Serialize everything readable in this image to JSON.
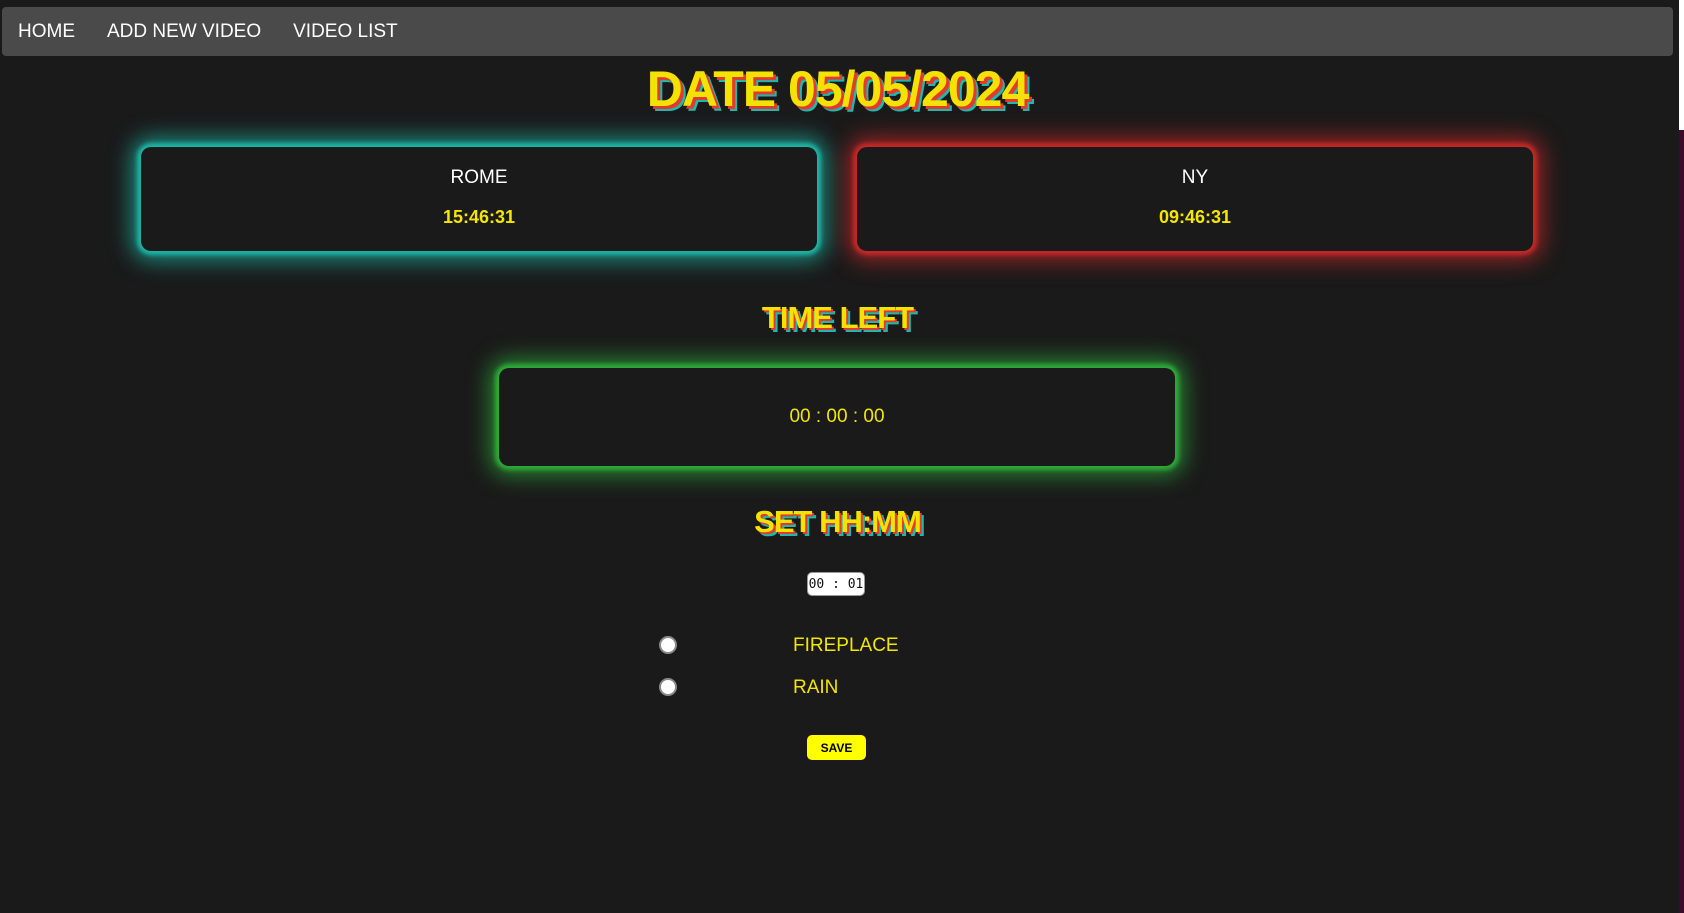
{
  "nav": {
    "items": [
      {
        "label": "HOME"
      },
      {
        "label": "ADD NEW VIDEO"
      },
      {
        "label": "VIDEO LIST"
      }
    ]
  },
  "header": {
    "date_title": "DATE 05/05/2024"
  },
  "clocks": [
    {
      "city": "ROME",
      "time": "15:46:31",
      "glow_color": "#1db5a5"
    },
    {
      "city": "NY",
      "time": "09:46:31",
      "glow_color": "#c62828"
    }
  ],
  "timer": {
    "title": "TIME LEFT",
    "value": "00 : 00 : 00",
    "glow_color": "#2eaa3a"
  },
  "setter": {
    "title": "SET HH:MM",
    "input_value": "00 : 01"
  },
  "sounds": [
    {
      "label": "FIREPLACE"
    },
    {
      "label": "RAIN"
    }
  ],
  "actions": {
    "save_label": "SAVE"
  },
  "colors": {
    "background": "#1a1a1a",
    "navbar": "#4a4a4a",
    "accent_yellow": "#f5e600",
    "title_shadow_red": "#e23b2d",
    "title_shadow_teal": "#1fb8b0"
  }
}
